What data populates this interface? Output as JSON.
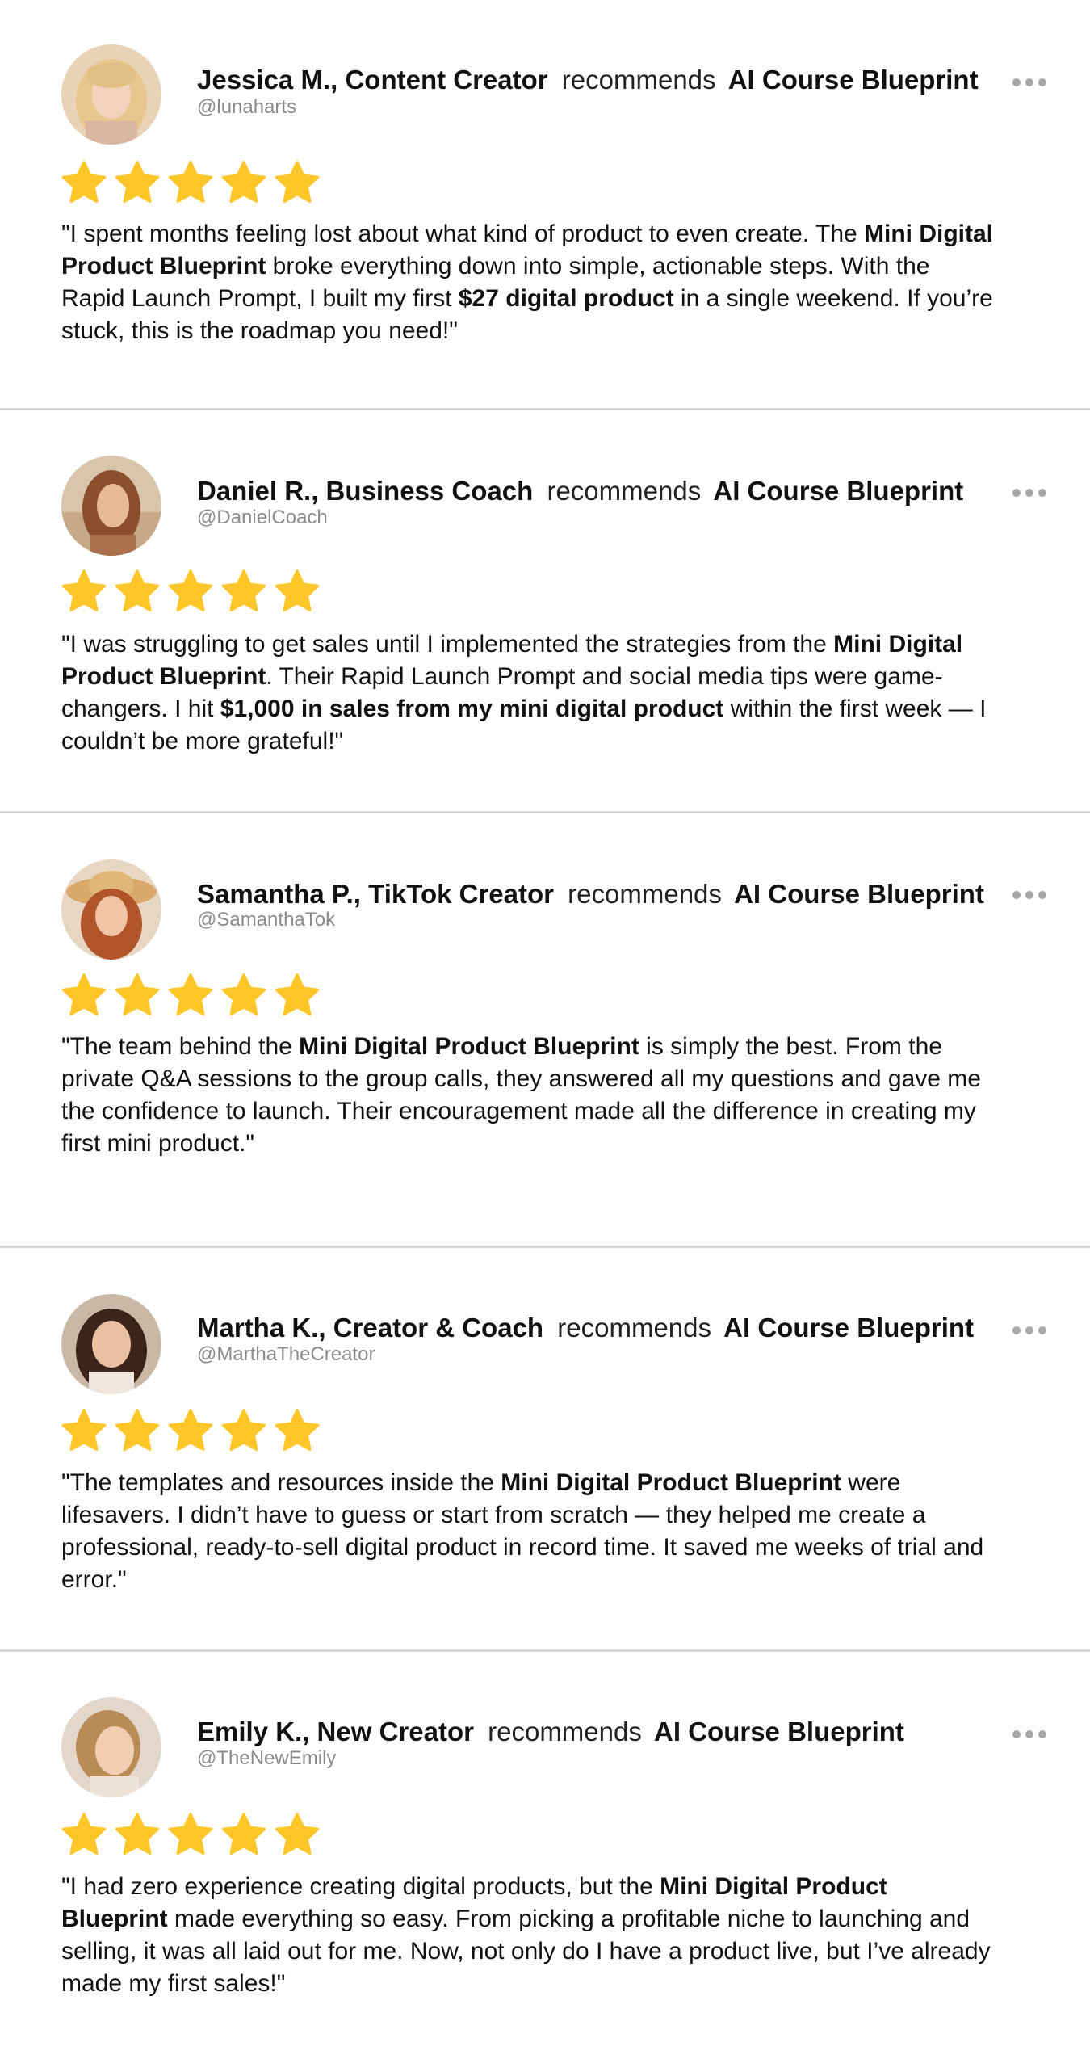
{
  "colors": {
    "star": "#FFC629",
    "divider": "#D6D6D6",
    "handle": "#8A8A8A",
    "text": "#111111"
  },
  "icons": {
    "star": "star-icon",
    "more": "more-horizontal-icon"
  },
  "reviews": [
    {
      "author": "Jessica M., Content Creator",
      "recommends": "recommends",
      "product": "AI Course Blueprint",
      "handle": "@lunaharts",
      "rating": 5,
      "body": [
        {
          "text": "\"I spent months feeling lost about what kind of product to even create. The "
        },
        {
          "text": "Mini Digital Product Blueprint",
          "bold": true
        },
        {
          "text": " broke everything down into simple, actionable steps. With the Rapid Launch Prompt, I built my first "
        },
        {
          "text": "$27 digital product",
          "bold": true
        },
        {
          "text": " in a single weekend. If you’re stuck, this is the roadmap you need!\""
        }
      ]
    },
    {
      "author": "Daniel R., Business Coach",
      "recommends": "recommends",
      "product": "AI Course Blueprint",
      "handle": "@DanielCoach",
      "rating": 5,
      "body": [
        {
          "text": "\"I was struggling to get sales until I implemented the strategies from the "
        },
        {
          "text": "Mini Digital Product Blueprint",
          "bold": true
        },
        {
          "text": ". Their Rapid Launch Prompt and social media tips were game-changers. I hit "
        },
        {
          "text": "$1,000 in sales from my mini digital product",
          "bold": true
        },
        {
          "text": " within the first week — I couldn’t be more grateful!\""
        }
      ]
    },
    {
      "author": "Samantha P., TikTok Creator",
      "recommends": "recommends",
      "product": "AI Course Blueprint",
      "handle": "@SamanthaTok",
      "rating": 5,
      "body": [
        {
          "text": "\"The team behind the "
        },
        {
          "text": "Mini Digital Product Blueprint",
          "bold": true
        },
        {
          "text": " is simply the best. From the private Q&A sessions to the group calls, they answered all my questions and gave me the confidence to launch. Their encouragement made all the difference in creating my first mini product.\""
        }
      ]
    },
    {
      "author": "Martha K., Creator & Coach",
      "recommends": "recommends",
      "product": "AI Course Blueprint",
      "handle": "@MarthaTheCreator",
      "rating": 5,
      "body": [
        {
          "text": "\"The templates and resources inside the "
        },
        {
          "text": "Mini Digital Product Blueprint",
          "bold": true
        },
        {
          "text": " were lifesavers. I didn’t have to guess or start from scratch — they helped me create a professional, ready-to-sell digital product in record time. It saved me weeks of trial and error.\""
        }
      ]
    },
    {
      "author": "Emily K., New Creator",
      "recommends": "recommends",
      "product": "AI Course Blueprint",
      "handle": "@TheNewEmily",
      "rating": 5,
      "body": [
        {
          "text": "\"I had zero experience creating digital products, but the "
        },
        {
          "text": "Mini Digital Product Blueprint",
          "bold": true
        },
        {
          "text": " made everything so easy. From picking a profitable niche to launching and selling, it was all laid out for me. Now, not only do I have a product live, but I’ve already made my first sales!\""
        }
      ]
    }
  ]
}
